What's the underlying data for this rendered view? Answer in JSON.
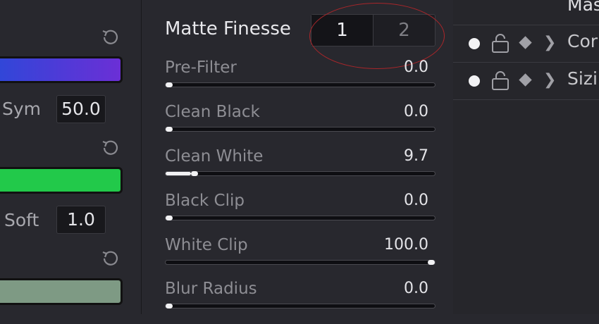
{
  "left_panel": {
    "sym_label": "Sym",
    "sym_value": "50.0",
    "soft_label": "Soft",
    "soft_value": "1.0",
    "reset_icon": "reset-icon",
    "colors": {
      "blue_bar": "#5a3de0",
      "green_bar": "#22c94a",
      "gray_bar": "#7e9a84"
    }
  },
  "matte_finesse": {
    "title": "Matte Finesse",
    "tabs": [
      {
        "label": "1",
        "active": true
      },
      {
        "label": "2",
        "active": false
      }
    ],
    "rows": [
      {
        "label": "Pre-Filter",
        "value": "0.0",
        "level": 0.0
      },
      {
        "label": "Clean Black",
        "value": "0.0",
        "level": 0.0
      },
      {
        "label": "Clean White",
        "value": "9.7",
        "level": 0.097
      },
      {
        "label": "Black Clip",
        "value": "0.0",
        "level": 0.0
      },
      {
        "label": "White Clip",
        "value": "100.0",
        "level": 1.0
      },
      {
        "label": "Blur Radius",
        "value": "0.0",
        "level": 0.0
      }
    ]
  },
  "right_panel": {
    "title": "Mas",
    "items": [
      {
        "label": "Cor"
      },
      {
        "label": "Sizi"
      }
    ],
    "icons": [
      "dot-icon",
      "lock-icon",
      "diamond-icon",
      "chevron-right-icon"
    ]
  }
}
